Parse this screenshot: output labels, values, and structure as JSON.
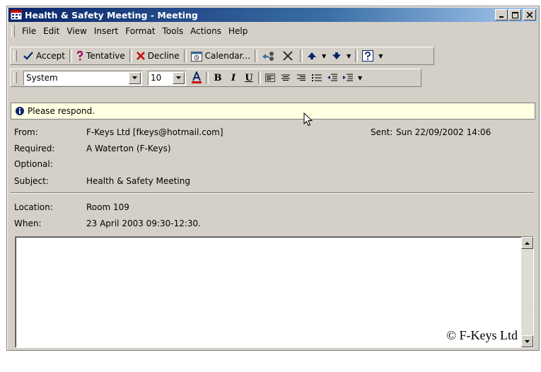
{
  "window": {
    "title": "Health & Safety Meeting - Meeting",
    "minimize_label": "_",
    "maximize_label": "□",
    "close_label": "×"
  },
  "menubar": {
    "items": [
      "File",
      "Edit",
      "View",
      "Insert",
      "Format",
      "Tools",
      "Actions",
      "Help"
    ]
  },
  "toolbar": {
    "accept_label": "Accept",
    "tentative_label": "Tentative",
    "decline_label": "Decline",
    "calendar_label": "Calendar...",
    "icons": [
      "checkmark-icon",
      "question-icon",
      "x-icon",
      "calendar-icon",
      "meeting-reply-icon",
      "delete-icon",
      "up-arrow-icon",
      "down-arrow-icon",
      "help-icon"
    ]
  },
  "formatting": {
    "font": "System",
    "size": "10",
    "bold_label": "B",
    "italic_label": "I",
    "underline_label": "U",
    "font_color": "#cc0000"
  },
  "infobar": {
    "message": "Please respond."
  },
  "headers": {
    "from_label": "From:",
    "from_value": "F-Keys Ltd [fkeys@hotmail.com]",
    "sent_label": "Sent:",
    "sent_value": "Sun 22/09/2002 14:06",
    "required_label": "Required:",
    "required_value": "A Waterton (F-Keys)",
    "optional_label": "Optional:",
    "optional_value": "",
    "subject_label": "Subject:",
    "subject_value": "Health & Safety Meeting",
    "location_label": "Location:",
    "location_value": "Room 109",
    "when_label": "When:",
    "when_value": "23 April 2003 09:30-12:30."
  },
  "body": {
    "watermark": "© F-Keys Ltd"
  },
  "colors": {
    "titlebar_start": "#0a246a",
    "infobar_bg": "#ffffe1",
    "chrome": "#d4d0c8"
  }
}
